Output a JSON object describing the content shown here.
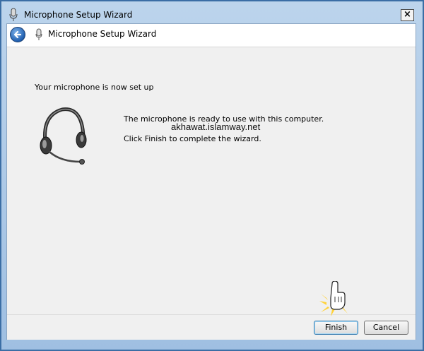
{
  "window": {
    "title": "Microphone Setup Wizard",
    "close_glyph": "×"
  },
  "navbar": {
    "title": "Microphone Setup Wizard",
    "back_icon": "back-arrow-icon"
  },
  "content": {
    "heading": "Your microphone is now set up",
    "message_ready": "The microphone is ready to use with this computer.",
    "message_finish": "Click Finish to complete the wizard.",
    "watermark": "akhawat.islamway.net"
  },
  "footer": {
    "finish_label": "Finish",
    "cancel_label": "Cancel"
  },
  "colors": {
    "frame": "#9fbfe2",
    "client_bg": "#f0f0f0",
    "back_button": "#1f5fb0"
  }
}
